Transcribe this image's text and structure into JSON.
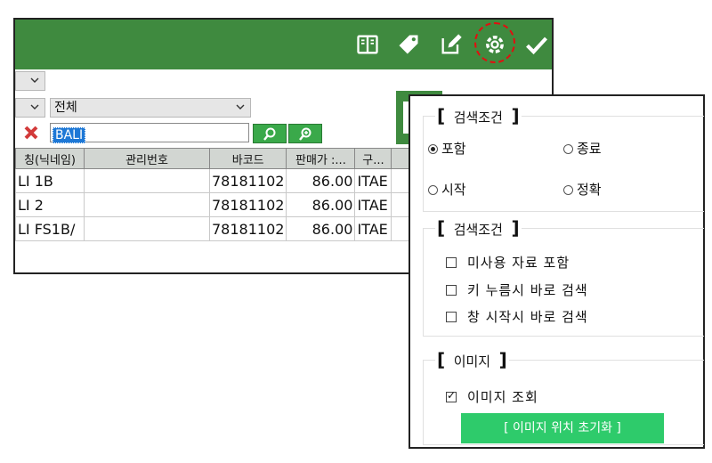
{
  "toolbar": {
    "icons": [
      "book-icon",
      "tag-icon",
      "edit-icon",
      "gear-icon",
      "check-icon"
    ],
    "highlight_color": "#e01010",
    "bar_color": "#3f8a3f"
  },
  "filter": {
    "category_value": "전체",
    "search_value": "BALI"
  },
  "table": {
    "headers": [
      "칭(닉네임)",
      "관리번호",
      "바코드",
      "판매가 :...",
      "구...",
      ""
    ],
    "rows": [
      [
        "LI 1B",
        "",
        "78181102",
        "86.00",
        "ITAE",
        ""
      ],
      [
        "LI 2",
        "",
        "78181102",
        "86.00",
        "ITAE",
        ""
      ],
      [
        "LI FS1B/",
        "",
        "78181102",
        "86.00",
        "ITAE",
        ""
      ]
    ]
  },
  "panel": {
    "search_condition_title": "검색조건",
    "match_options": {
      "include": "포함",
      "end": "종료",
      "start": "시작",
      "exact": "정확"
    },
    "match_selected": "include",
    "search_condition2_title": "검색조건",
    "checks": [
      {
        "label": "미사용 자료 포함",
        "checked": false
      },
      {
        "label": "키 누름시 바로 검색",
        "checked": false
      },
      {
        "label": "창 시작시 바로 검색",
        "checked": false
      }
    ],
    "image_title": "이미지",
    "image_check": {
      "label": "이미지 조회",
      "checked": true
    },
    "reset_button": "[ 이미지 위치 초기화 ]",
    "button_color": "#2ecb6b"
  }
}
